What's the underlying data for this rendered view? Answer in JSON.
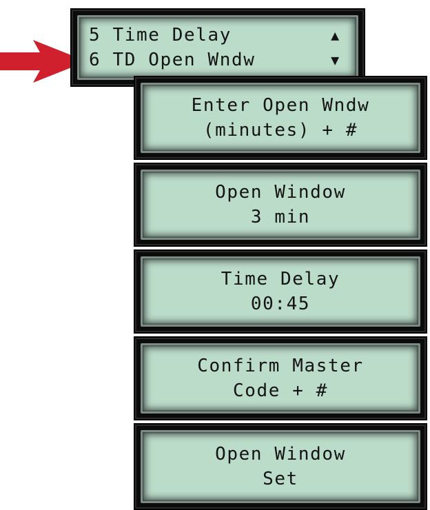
{
  "menu_display": {
    "rows": [
      {
        "text": "5 Time Delay",
        "arrow": "▲"
      },
      {
        "text": "6 TD Open Wndw",
        "arrow": "▼"
      }
    ],
    "highlighted_row": 2
  },
  "prompt_displays": [
    {
      "id": "enter-open-window",
      "line1": "Enter Open Wndw",
      "line2": "(minutes) + #"
    },
    {
      "id": "open-window-value",
      "line1": "Open Window",
      "line2": "3 min"
    },
    {
      "id": "time-delay-value",
      "line1": "Time Delay",
      "line2": "00:45"
    },
    {
      "id": "confirm-master-code",
      "line1": "Confirm Master",
      "line2": "Code + #"
    },
    {
      "id": "open-window-set",
      "line1": "Open Window",
      "line2": "Set"
    }
  ],
  "icons": {
    "pointer": "red-arrow-right-icon",
    "scroll_up": "triangle-up-icon",
    "scroll_down": "triangle-down-icon"
  },
  "colors": {
    "lcd_background": "#bcdcca",
    "lcd_text": "#141414",
    "bezel": "#0b0b0b",
    "pointer_arrow": "#d0202e"
  }
}
